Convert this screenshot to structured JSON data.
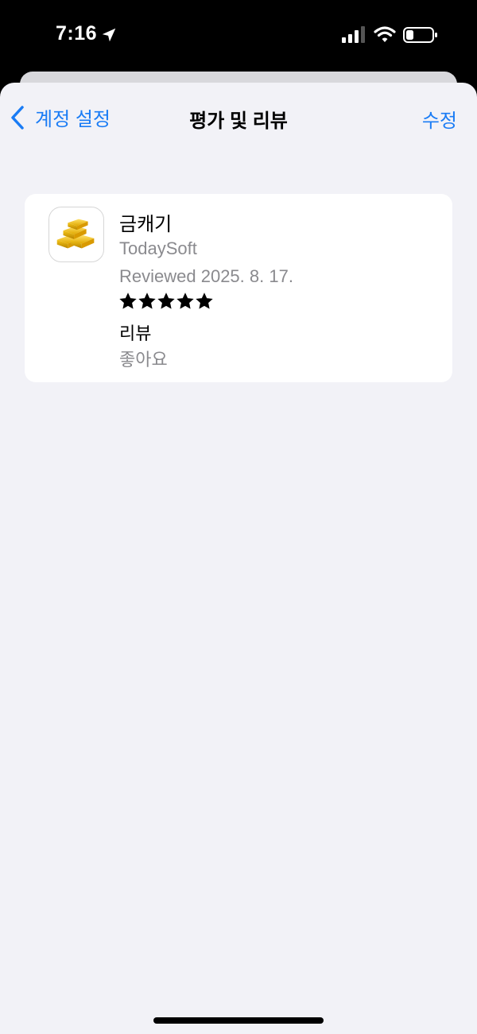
{
  "status_bar": {
    "time": "7:16",
    "icons": [
      "location-arrow-icon",
      "cellular-signal-icon",
      "wifi-icon",
      "battery-icon"
    ]
  },
  "nav": {
    "back_label": "계정 설정",
    "title": "평가 및 리뷰",
    "edit_label": "수정"
  },
  "review": {
    "app_name": "금캐기",
    "developer": "TodaySoft",
    "reviewed_date": "Reviewed 2025. 8. 17.",
    "rating": 5,
    "rating_max": 5,
    "title": "리뷰",
    "body": "좋아요"
  },
  "colors": {
    "accent": "#1a7cf5",
    "background": "#f2f2f7",
    "secondary_text": "#8a8a8e"
  }
}
